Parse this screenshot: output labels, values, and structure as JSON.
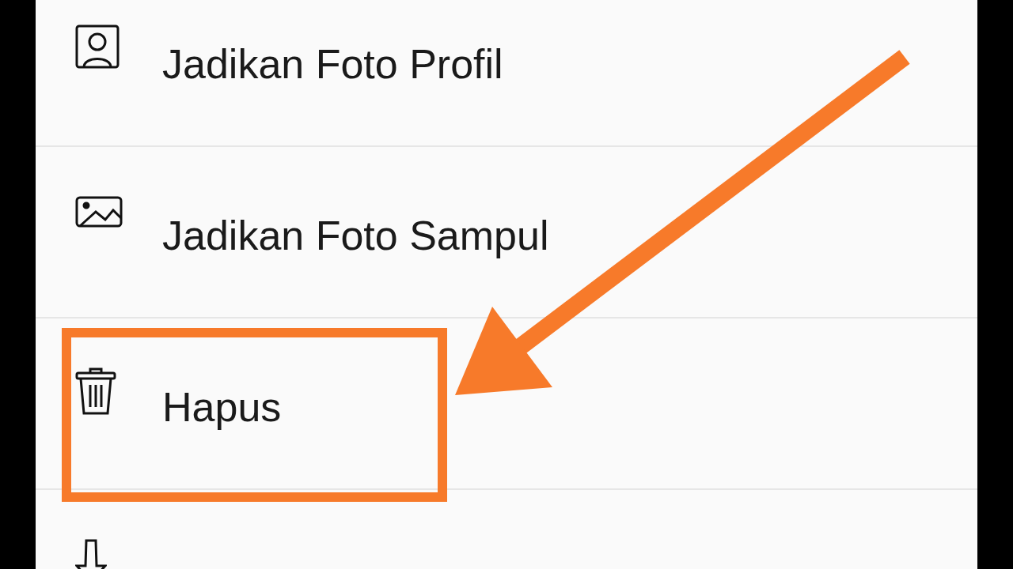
{
  "menu": {
    "items": [
      {
        "kind": "profile",
        "label": "Jadikan Foto Profil",
        "highlighted": false
      },
      {
        "kind": "cover",
        "label": "Jadikan Foto Sampul",
        "highlighted": false
      },
      {
        "kind": "delete",
        "label": "Hapus",
        "highlighted": true
      },
      {
        "kind": "download",
        "highlighted": false
      }
    ]
  },
  "annotation": {
    "kind": "arrow"
  }
}
